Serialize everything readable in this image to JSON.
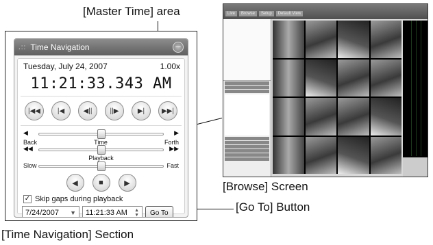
{
  "callouts": {
    "master_time": "[Master Time] area",
    "browse": "[Browse] Screen",
    "goto": "[Go To] Button",
    "section": "[Time Navigation] Section"
  },
  "panel": {
    "title": "Time Navigation",
    "date": "Tuesday, July 24, 2007",
    "speed": "1.00x",
    "time": "11:21:33.343 AM",
    "slider_time": {
      "left": "Back",
      "center": "Time",
      "right": "Forth",
      "position": 0.5
    },
    "slider_playback": {
      "left": "Slow",
      "center": "Playback",
      "right": "Fast",
      "position": 0.5
    },
    "skip_label": "Skip gaps during playback",
    "skip_checked": true,
    "goto_date": "7/24/2007",
    "goto_time": "11:21:33 AM",
    "goto_label": "Go To"
  },
  "browse": {
    "tabs": [
      "Live",
      "Browse",
      "Setup",
      "Default View"
    ]
  }
}
